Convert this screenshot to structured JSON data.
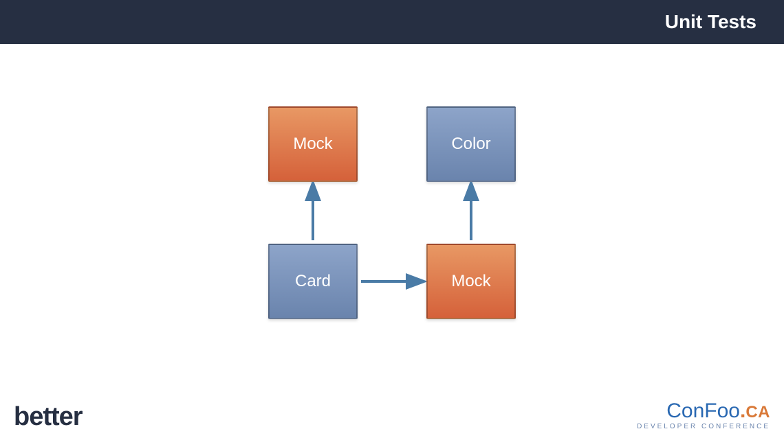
{
  "header": {
    "title": "Unit Tests"
  },
  "diagram": {
    "boxes": {
      "top_left": {
        "label": "Mock",
        "color": "orange"
      },
      "top_right": {
        "label": "Color",
        "color": "blue"
      },
      "bottom_left": {
        "label": "Card",
        "color": "blue"
      },
      "bottom_right": {
        "label": "Mock",
        "color": "orange"
      }
    },
    "arrows": [
      {
        "from": "bottom_left",
        "to": "top_left",
        "direction": "up"
      },
      {
        "from": "bottom_left",
        "to": "bottom_right",
        "direction": "right"
      },
      {
        "from": "bottom_right",
        "to": "top_right",
        "direction": "up"
      }
    ],
    "arrow_color": "#4a7ba6"
  },
  "footer": {
    "left_logo": "better",
    "right_logo": {
      "part1": "Con",
      "part2": "Foo",
      "dot": ".",
      "part3": "CA",
      "subtitle": "DEVELOPER CONFERENCE"
    }
  }
}
